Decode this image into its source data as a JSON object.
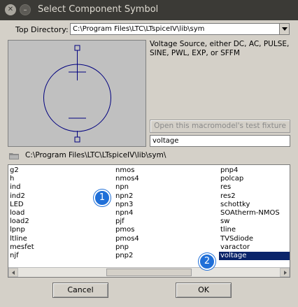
{
  "window": {
    "title": "Select Component Symbol"
  },
  "top_directory": {
    "label": "Top Directory:",
    "value": "C:\\Program Files\\LTC\\LTspiceIV\\lib\\sym"
  },
  "description": "Voltage Source, either DC, AC, PULSE, SINE, PWL, EXP, or SFFM",
  "fixture_button": "Open this macromodel's test fixture",
  "name_field": "voltage",
  "current_path": "C:\\Program Files\\LTC\\LTspiceIV\\lib\\sym\\",
  "columns": [
    [
      "g2",
      "h",
      "ind",
      "ind2",
      "LED",
      "load",
      "load2",
      "lpnp",
      "ltline",
      "mesfet",
      "njf"
    ],
    [
      "nmos",
      "nmos4",
      "npn",
      "npn2",
      "npn3",
      "npn4",
      "pjf",
      "pmos",
      "pmos4",
      "pnp",
      "pnp2"
    ],
    [
      "pnp4",
      "polcap",
      "res",
      "res2",
      "schottky",
      "SOAtherm-NMOS",
      "sw",
      "tline",
      "TVSdiode",
      "varactor",
      "voltage"
    ]
  ],
  "selected_item": "voltage",
  "buttons": {
    "cancel": "Cancel",
    "ok": "OK"
  },
  "annotations": {
    "badge1": "1",
    "badge2": "2"
  },
  "colors": {
    "symbol_stroke": "#00007f",
    "selection": "#0a246a",
    "badge": "#1f6fd8"
  }
}
